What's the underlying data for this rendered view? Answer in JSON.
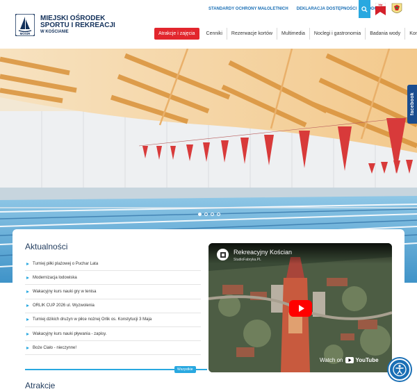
{
  "brand": {
    "line1": "MIEJSKI OŚRODEK",
    "line2": "SPORTU I REKREACJI",
    "line3": "W KOŚCIANIE",
    "logo_text": "MOSiR"
  },
  "top_links": [
    "STANDARDY OCHRONY MAŁOLETNICH",
    "DEKLARACJA DOSTĘPNOŚCI",
    "RODO"
  ],
  "nav": [
    "Atrakcje i zajęcia",
    "Cenniki",
    "Rezerwacje kortów",
    "Multimedia",
    "Noclegi i gastronomia",
    "Badania wody",
    "Kontakt"
  ],
  "bip_label": "bip",
  "facebook_label": "facebook",
  "news": {
    "title": "Aktualności",
    "items": [
      "Turniej piłki plażowej o Puchar Lata",
      "Modernizacja lodowiska",
      "Wakacyjny kurs nauki gry w tenisa",
      "ORLIK CUP 2026 ul. Wyzwolenia",
      "Turniej dzikich drużyn w piłce nożnej Orlik os. Konstytucji 3 Maja",
      "Wakacyjny kurs nauki pływania - zapisy.",
      "Boże Ciało - nieczynne!"
    ],
    "all_label": "Wszystkie"
  },
  "video": {
    "title": "Rekreacyjny Kościan",
    "channel": "StudioFabryka.PL",
    "watch_on": "Watch on",
    "youtube": "YouTube"
  },
  "section2_title": "Atrakcje",
  "colors": {
    "accent": "#29a8e0",
    "nav_active": "#e2262d",
    "brand_text": "#12305a",
    "facebook": "#1a4d8f"
  },
  "icons": [
    "search-icon",
    "bip-flag-icon",
    "eagle-emblem-icon",
    "play-icon",
    "youtube-icon",
    "accessibility-icon"
  ]
}
